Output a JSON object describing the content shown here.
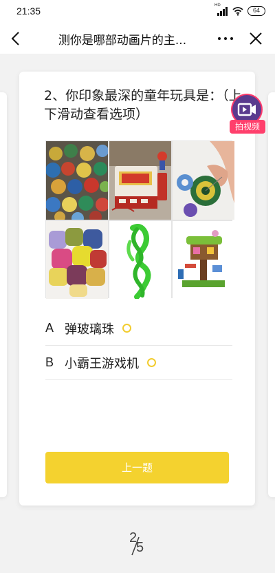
{
  "status_bar": {
    "time": "21:35",
    "network": "HD",
    "battery": "64"
  },
  "nav": {
    "title": "测你是哪部动画片的主...",
    "back_icon": "chevron-left-icon",
    "more_icon": "more-dots-icon",
    "close_icon": "close-icon"
  },
  "question": {
    "text": "2、你印象最深的童年玩具是：（上下滑动查看选项）",
    "images": [
      "marbles",
      "famicom-console",
      "yoyo",
      "sandbags",
      "green-jump-rope",
      "lego-treehouse"
    ]
  },
  "options": [
    {
      "letter": "A",
      "text": "弹玻璃珠"
    },
    {
      "letter": "B",
      "text": "小霸王游戏机"
    }
  ],
  "prev_button": {
    "label": "上一题"
  },
  "video_float": {
    "label": "拍视频",
    "icon": "video-camera-icon"
  },
  "page_indicator": {
    "current": "2",
    "total": "5"
  },
  "colors": {
    "accent": "#f4d22f",
    "video_badge": "#ff3f6c"
  }
}
